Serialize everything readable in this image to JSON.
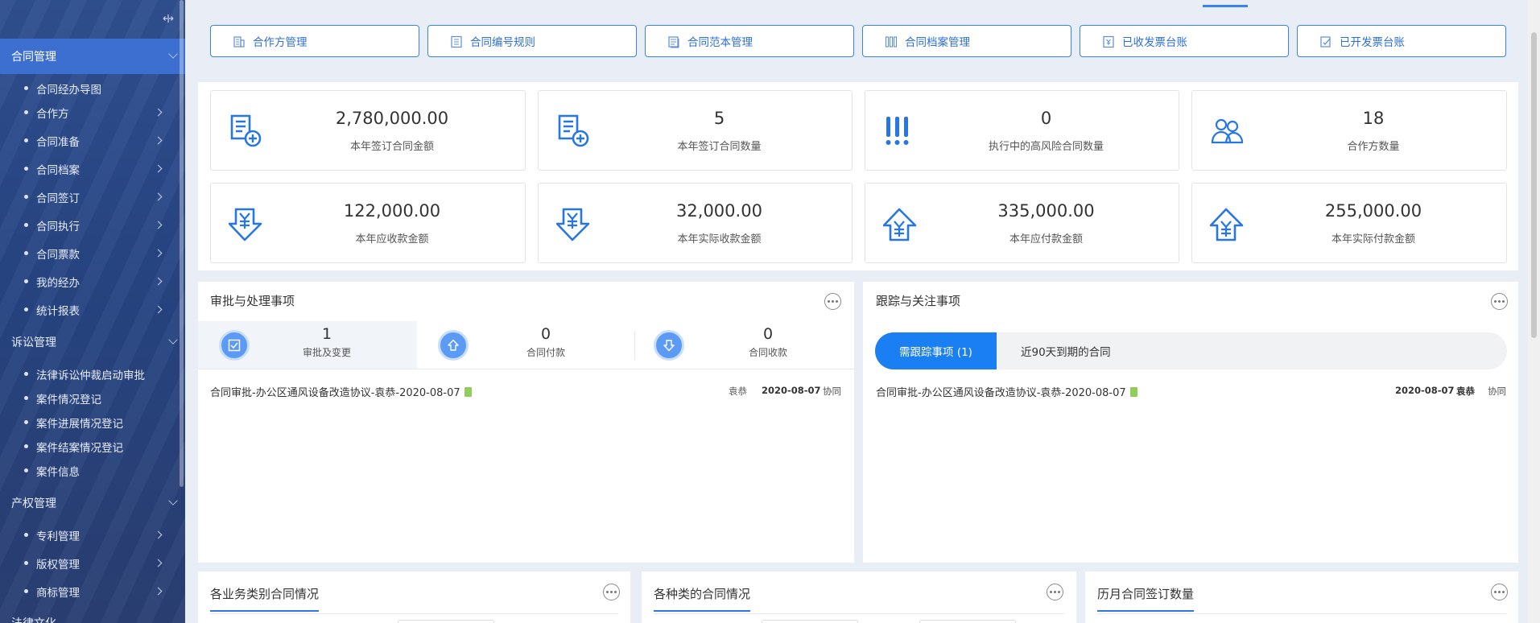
{
  "colors": {
    "accent": "#3a82f0",
    "sidebar_bg": "#2f4f8f",
    "sidebar_active": "#3d6fd0",
    "pill_active": "#1a7ff2"
  },
  "sidebar": {
    "collapse_icon": "collapse-arrows-icon",
    "groups": [
      {
        "label": "合同管理",
        "active": true,
        "items": [
          "合同经办导图",
          "合作方",
          "合同准备",
          "合同档案",
          "合同签订",
          "合同执行",
          "合同票款",
          "我的经办",
          "统计报表"
        ]
      },
      {
        "label": "诉讼管理",
        "active": false,
        "items": [
          "法律诉讼仲裁启动审批",
          "案件情况登记",
          "案件进展情况登记",
          "案件结案情况登记",
          "案件信息"
        ]
      },
      {
        "label": "产权管理",
        "active": false,
        "items": [
          "专利管理",
          "版权管理",
          "商标管理"
        ]
      },
      {
        "label": "法律文化",
        "active": false,
        "items": []
      }
    ]
  },
  "quick_links": [
    {
      "label": "合作方管理",
      "icon": "building-icon"
    },
    {
      "label": "合同编号规则",
      "icon": "list-icon"
    },
    {
      "label": "合同范本管理",
      "icon": "template-icon"
    },
    {
      "label": "合同档案管理",
      "icon": "archive-icon"
    },
    {
      "label": "已收发票台账",
      "icon": "received-invoice-icon"
    },
    {
      "label": "已开发票台账",
      "icon": "issued-invoice-icon"
    }
  ],
  "stats": [
    {
      "value": "2,780,000.00",
      "label": "本年签订合同金额",
      "icon": "contract-add-icon"
    },
    {
      "value": "5",
      "label": "本年签订合同数量",
      "icon": "contract-add-icon"
    },
    {
      "value": "0",
      "label": "执行中的高风险合同数量",
      "icon": "exclamation-icon"
    },
    {
      "value": "18",
      "label": "合作方数量",
      "icon": "partners-icon"
    },
    {
      "value": "122,000.00",
      "label": "本年应收款金额",
      "icon": "yuan-in-icon"
    },
    {
      "value": "32,000.00",
      "label": "本年实际收款金额",
      "icon": "yuan-in-icon"
    },
    {
      "value": "335,000.00",
      "label": "本年应付款金额",
      "icon": "yuan-out-icon"
    },
    {
      "value": "255,000.00",
      "label": "本年实际付款金额",
      "icon": "yuan-out-icon"
    }
  ],
  "approval": {
    "title": "审批与处理事项",
    "tabs": [
      {
        "count": "1",
        "label": "审批及变更"
      },
      {
        "count": "0",
        "label": "合同付款"
      },
      {
        "count": "0",
        "label": "合同收款"
      }
    ],
    "rows": [
      {
        "title": "合同审批-办公区通风设备改造协议-袁恭-2020-08-07",
        "person": "袁恭",
        "date": "2020-08-07",
        "action": "协同"
      }
    ]
  },
  "tracking": {
    "title": "跟踪与关注事项",
    "tabs": [
      "需跟踪事项 (1)",
      "近90天到期的合同"
    ],
    "rows": [
      {
        "title": "合同审批-办公区通风设备改造协议-袁恭-2020-08-07",
        "date": "2020-08-07",
        "person": "袁恭",
        "action": "协同"
      }
    ]
  },
  "bottom_panels": [
    "各业务类别合同情况",
    "各种类的合同情况",
    "历月合同签订数量"
  ]
}
